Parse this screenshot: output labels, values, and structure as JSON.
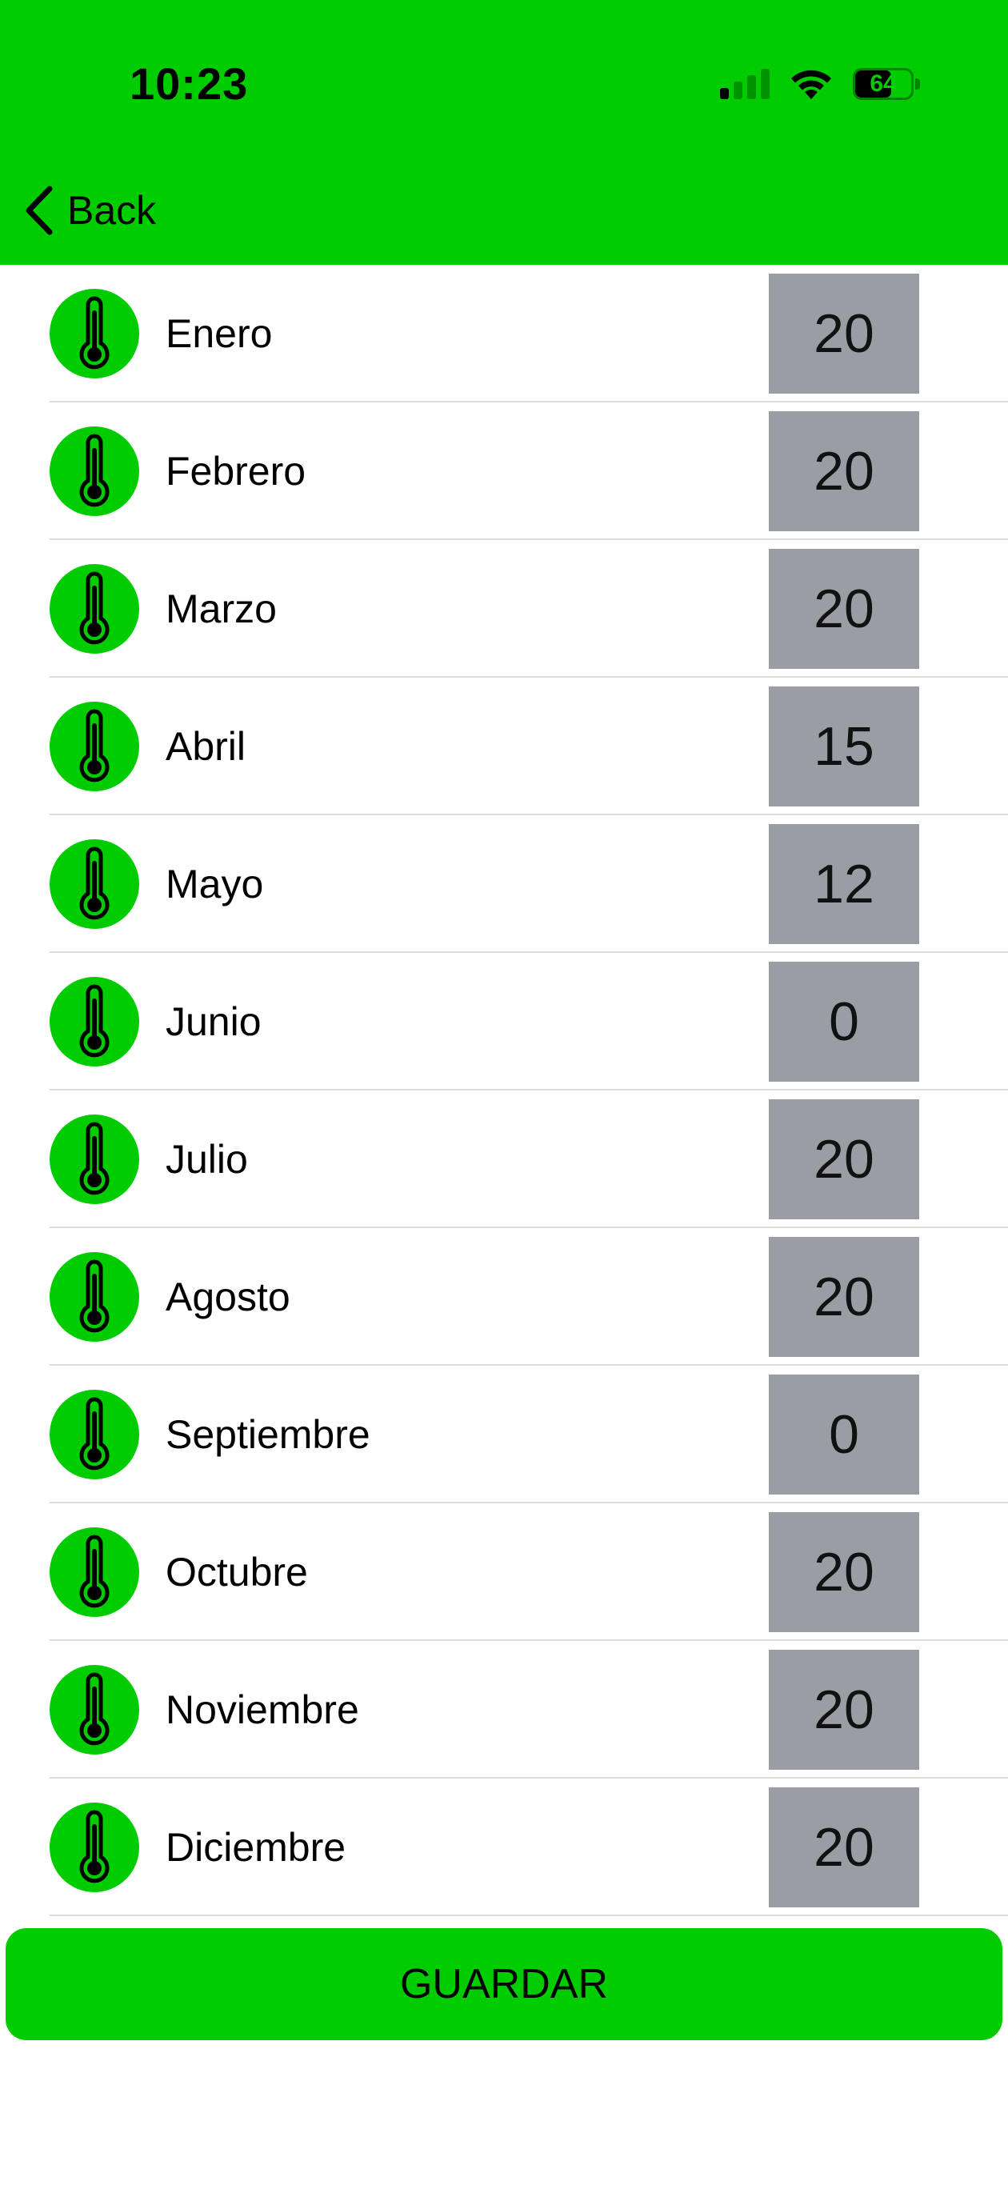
{
  "status_bar": {
    "time": "10:23",
    "battery": "64",
    "battery_level": 0.64,
    "signal_bars_active": 1,
    "signal_bars_total": 4
  },
  "nav": {
    "back_label": "Back"
  },
  "colors": {
    "accent": "#00cc00",
    "value_box": "#9a9da3",
    "divider": "#dcdcdc"
  },
  "icons": {
    "row": "thermometer-icon",
    "back": "chevron-left-icon"
  },
  "months": [
    {
      "label": "Enero",
      "value": "20"
    },
    {
      "label": "Febrero",
      "value": "20"
    },
    {
      "label": "Marzo",
      "value": "20"
    },
    {
      "label": "Abril",
      "value": "15"
    },
    {
      "label": "Mayo",
      "value": "12"
    },
    {
      "label": "Junio",
      "value": "0"
    },
    {
      "label": "Julio",
      "value": "20"
    },
    {
      "label": "Agosto",
      "value": "20"
    },
    {
      "label": "Septiembre",
      "value": "0"
    },
    {
      "label": "Octubre",
      "value": "20"
    },
    {
      "label": "Noviembre",
      "value": "20"
    },
    {
      "label": "Diciembre",
      "value": "20"
    }
  ],
  "actions": {
    "save_label": "GUARDAR"
  }
}
